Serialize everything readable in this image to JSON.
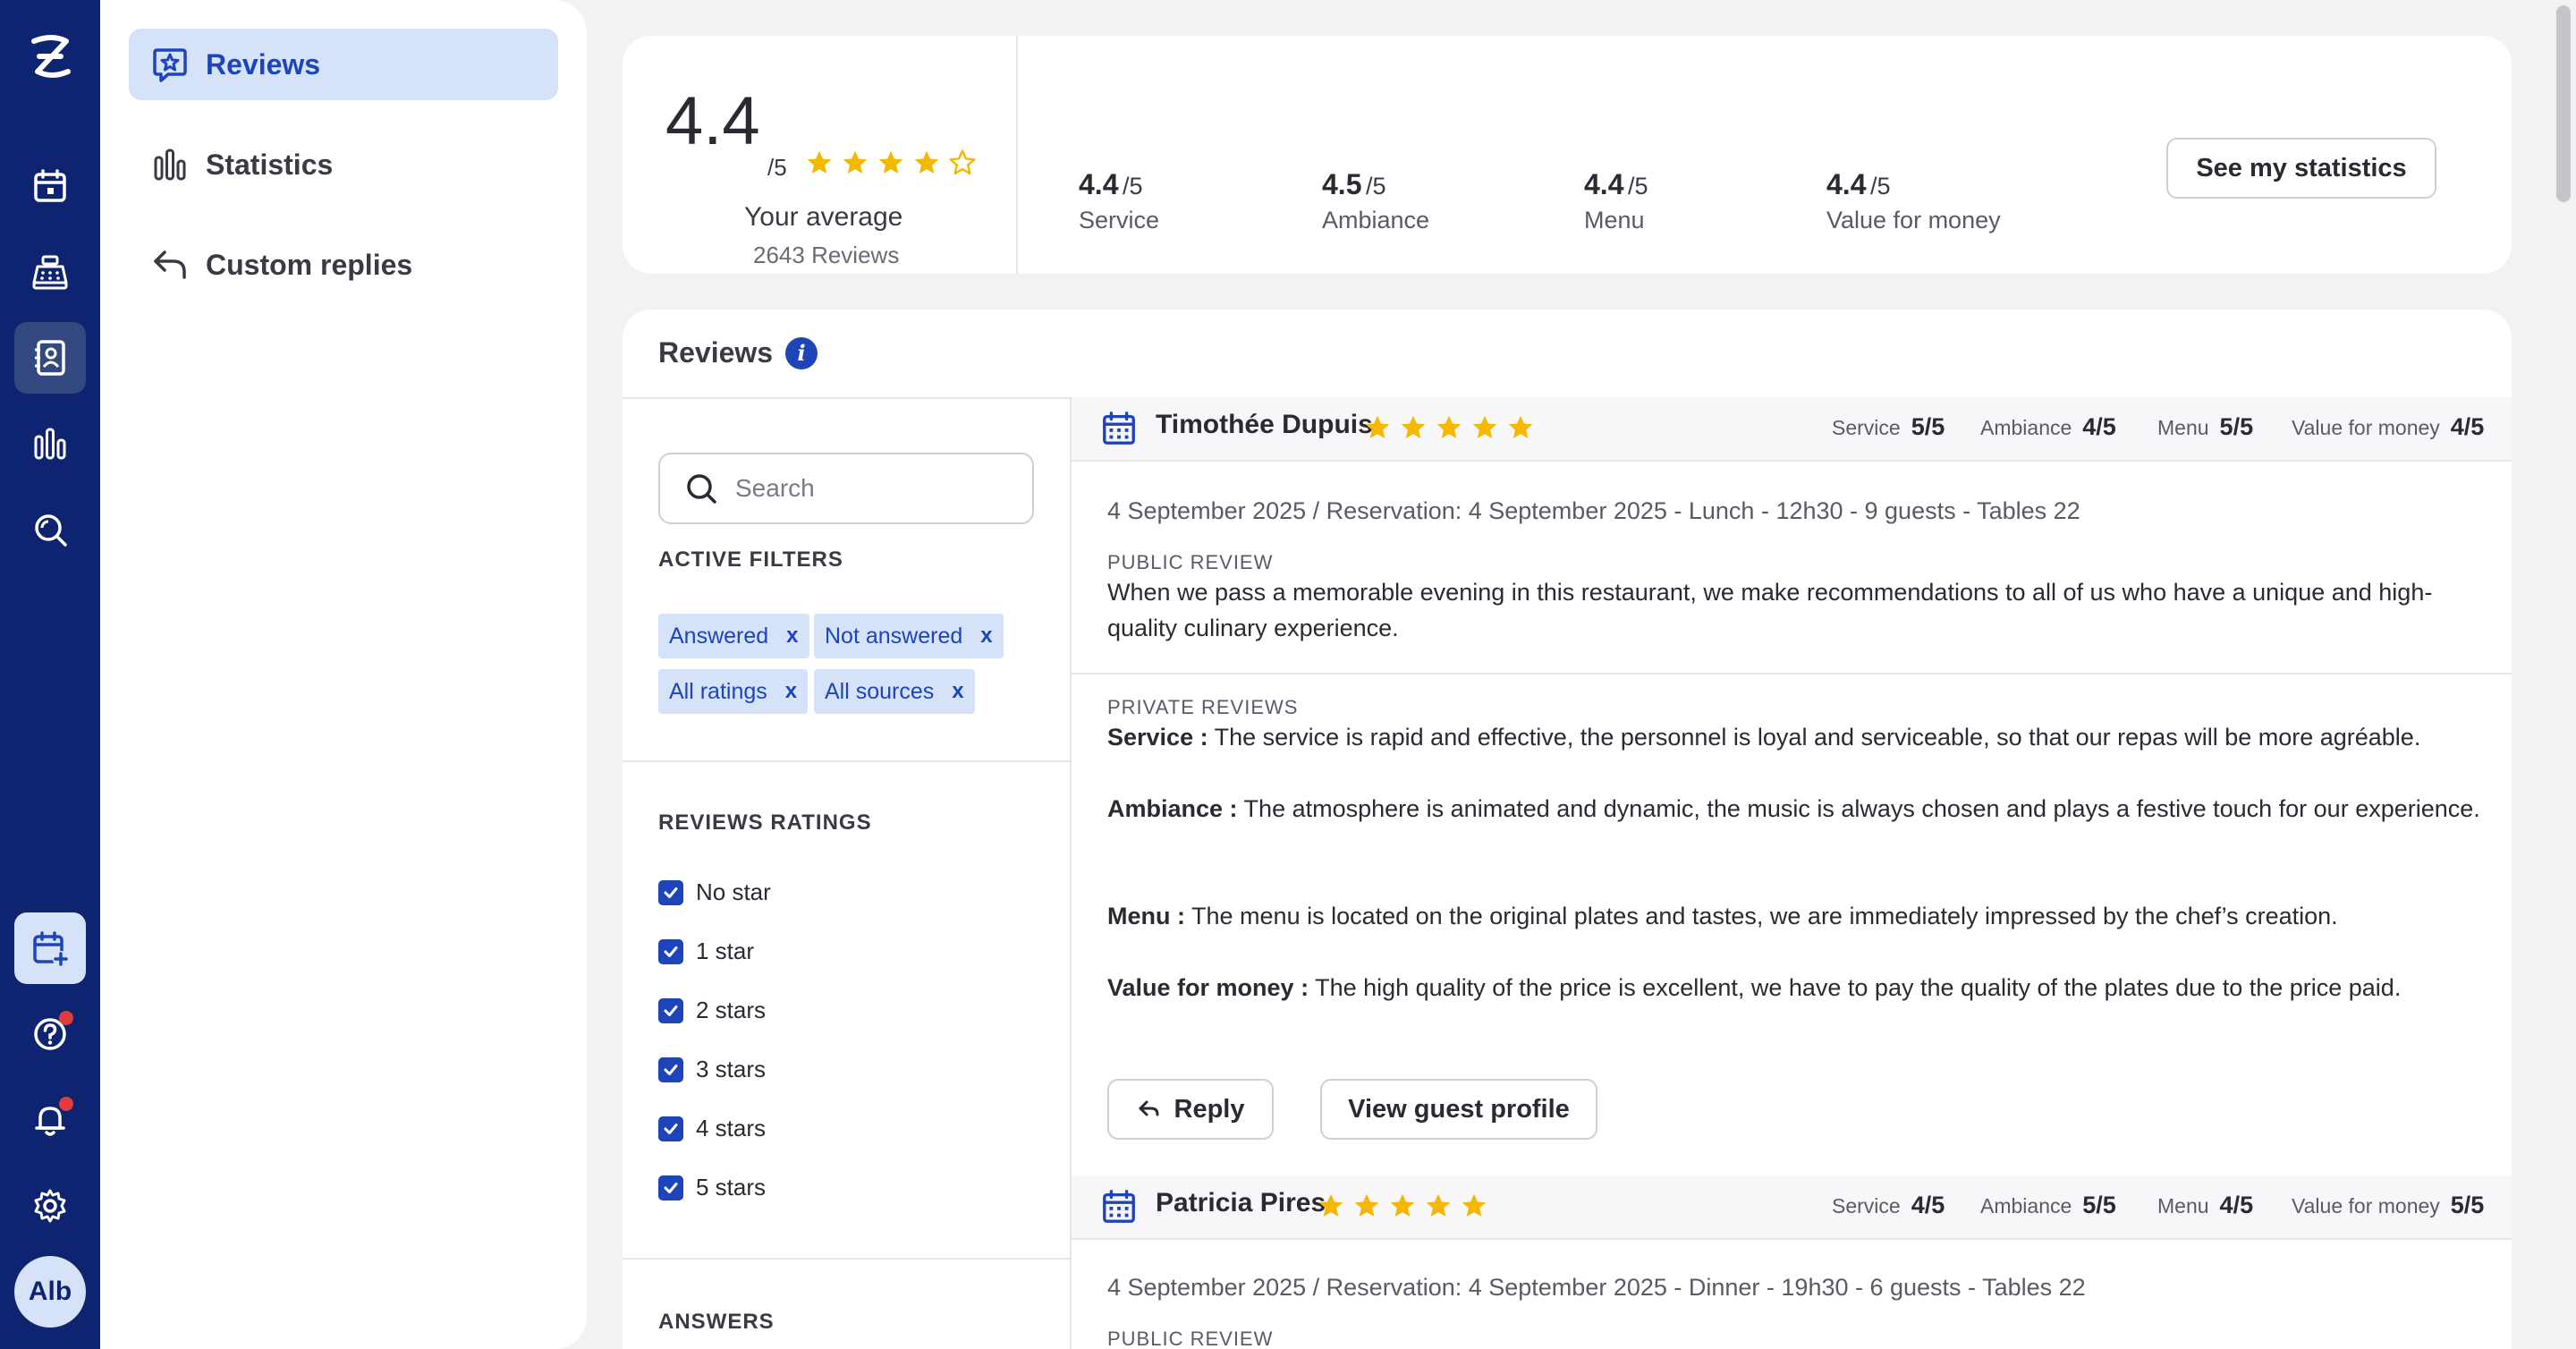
{
  "app": {
    "logo": "Z",
    "avatar_initials": "Alb"
  },
  "rail": {
    "icons": [
      "calendar-icon",
      "cash-register-icon",
      "guest-book-icon",
      "bar-chart-icon",
      "search-icon"
    ],
    "bottom_icons": [
      "calendar-plus-icon",
      "help-icon",
      "bell-icon",
      "gear-icon"
    ]
  },
  "subnav": {
    "items": [
      {
        "label": "Reviews",
        "icon": "star-badge-icon"
      },
      {
        "label": "Statistics",
        "icon": "bar-chart-icon"
      },
      {
        "label": "Custom replies",
        "icon": "reply-icon"
      }
    ]
  },
  "summary": {
    "average": "4.4",
    "out_of": "/5",
    "stars": 4.4,
    "average_label": "Your average",
    "review_count": "2643 Reviews",
    "metrics": [
      {
        "value": "4.4",
        "out_of": "/5",
        "label": "Service"
      },
      {
        "value": "4.5",
        "out_of": "/5",
        "label": "Ambiance"
      },
      {
        "value": "4.4",
        "out_of": "/5",
        "label": "Menu"
      },
      {
        "value": "4.4",
        "out_of": "/5",
        "label": "Value for money"
      }
    ],
    "stats_button": "See my statistics"
  },
  "reviews": {
    "title": "Reviews",
    "info": "i",
    "search_placeholder": "Search",
    "active_filters_heading": "ACTIVE FILTERS",
    "active_filters": [
      "Answered",
      "Not answered",
      "All ratings",
      "All sources"
    ],
    "chip_remove": "x",
    "ratings_heading": "REVIEWS RATINGS",
    "ratings": [
      "No star",
      "1 star",
      "2 stars",
      "3 stars",
      "4 stars",
      "5 stars"
    ],
    "answers_heading": "ANSWERS",
    "public_heading": "PUBLIC REVIEW",
    "private_heading": "PRIVATE REVIEWS",
    "reply_button": "Reply",
    "guest_profile_button": "View guest profile",
    "entries": [
      {
        "name": "Timothée Dupuis",
        "stars": 5,
        "criteria": [
          {
            "label": "Service",
            "value": "5/5"
          },
          {
            "label": "Ambiance",
            "value": "4/5"
          },
          {
            "label": "Menu",
            "value": "5/5"
          },
          {
            "label": "Value for money",
            "value": "4/5"
          }
        ],
        "meta": "4 September 2025 / Reservation: 4 September 2025 - Lunch - 12h30 - 9 guests - Tables 22",
        "public_text": "When we pass a memorable evening in this restaurant, we make recommendations to all of us who have a unique and high-quality culinary experience.",
        "private": [
          {
            "label": "Service :",
            "text": " The service is rapid and effective, the personnel is loyal and serviceable, so that our repas will be more agréable."
          },
          {
            "label": "Ambiance :",
            "text": " The atmosphere is animated and dynamic, the music is always chosen and plays a festive touch for our experience."
          },
          {
            "label": "Menu :",
            "text": " The menu is located on the original plates and tastes, we are immediately impressed by the chef’s creation."
          },
          {
            "label": "Value for money :",
            "text": " The high quality of the price is excellent, we have to pay the quality of the plates due to the price paid."
          }
        ]
      },
      {
        "name": "Patricia Pires",
        "stars": 5,
        "criteria": [
          {
            "label": "Service",
            "value": "4/5"
          },
          {
            "label": "Ambiance",
            "value": "5/5"
          },
          {
            "label": "Menu",
            "value": "4/5"
          },
          {
            "label": "Value for money",
            "value": "5/5"
          }
        ],
        "meta": "4 September 2025 / Reservation: 4 September 2025 - Dinner - 19h30 - 6 guests - Tables 22"
      }
    ]
  },
  "colors": {
    "rail": "#0e2470",
    "accent": "#1d44b8",
    "accent_light": "#d6e2f8",
    "star": "#f5b800",
    "alert": "#e23b3b"
  }
}
